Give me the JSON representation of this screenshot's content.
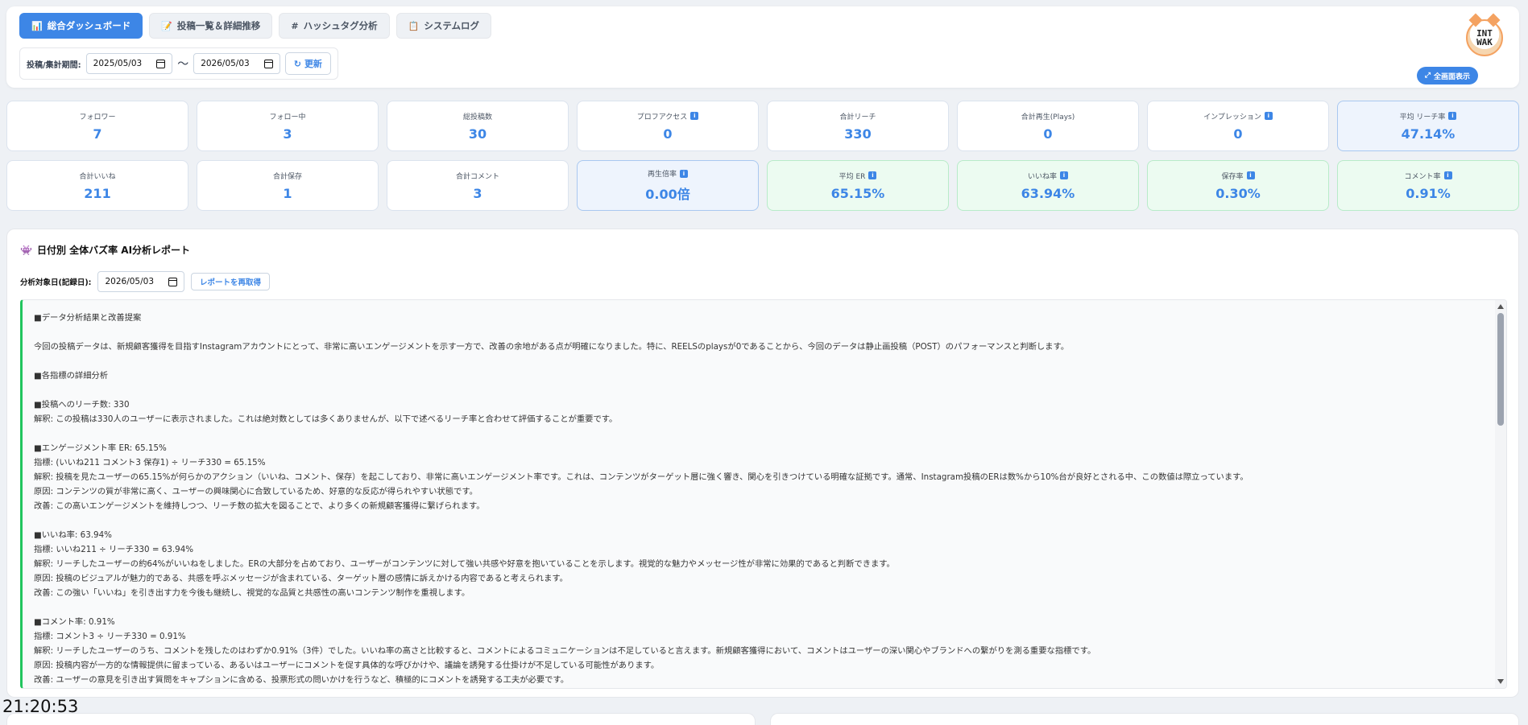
{
  "tabs": [
    {
      "icon": "📊",
      "label": "総合ダッシュボード"
    },
    {
      "icon": "📝",
      "label": "投稿一覧＆詳細推移"
    },
    {
      "icon": "#",
      "label": "ハッシュタグ分析"
    },
    {
      "icon": "📋",
      "label": "システムログ"
    }
  ],
  "period": {
    "label": "投稿/集計期間:",
    "start": "2025/05/03",
    "separator": "〜",
    "end": "2026/05/03",
    "refresh_label": "更新"
  },
  "header": {
    "logo_text": "INT WAK",
    "fullscreen_label": "全画面表示"
  },
  "kpis_row1": [
    {
      "label": "フォロワー",
      "value": "7"
    },
    {
      "label": "フォロー中",
      "value": "3"
    },
    {
      "label": "総投稿数",
      "value": "30"
    },
    {
      "label": "プロフアクセス",
      "value": "0"
    },
    {
      "label": "合計リーチ",
      "value": "330"
    },
    {
      "label": "合計再生(Plays)",
      "value": "0"
    },
    {
      "label": "インプレッション",
      "value": "0"
    },
    {
      "label": "平均 リーチ率",
      "value": "47.14%"
    }
  ],
  "kpis_row2": [
    {
      "label": "合計いいね",
      "value": "211"
    },
    {
      "label": "合計保存",
      "value": "1"
    },
    {
      "label": "合計コメント",
      "value": "3"
    },
    {
      "label": "再生倍率",
      "value": "0.00倍"
    },
    {
      "label": "平均 ER",
      "value": "65.15%"
    },
    {
      "label": "いいね率",
      "value": "63.94%"
    },
    {
      "label": "保存率",
      "value": "0.30%"
    },
    {
      "label": "コメント率",
      "value": "0.91%"
    }
  ],
  "report": {
    "title": "日付別 全体バズ率 AI分析レポート",
    "date_label": "分析対象日(記録日):",
    "date_value": "2026/05/03",
    "refetch_label": "レポートを再取得",
    "lines": [
      "■データ分析結果と改善提案",
      "",
      "今回の投稿データは、新規顧客獲得を目指すInstagramアカウントにとって、非常に高いエンゲージメントを示す一方で、改善の余地がある点が明確になりました。特に、REELSのplaysが0であることから、今回のデータは静止画投稿（POST）のパフォーマンスと判断します。",
      "",
      "■各指標の詳細分析",
      "",
      "■投稿へのリーチ数: 330",
      "解釈: この投稿は330人のユーザーに表示されました。これは絶対数としては多くありませんが、以下で述べるリーチ率と合わせて評価することが重要です。",
      "",
      "■エンゲージメント率 ER: 65.15%",
      "指標: (いいね211 コメント3 保存1) ÷ リーチ330 = 65.15%",
      "解釈: 投稿を見たユーザーの65.15%が何らかのアクション（いいね、コメント、保存）を起こしており、非常に高いエンゲージメント率です。これは、コンテンツがターゲット層に強く響き、関心を引きつけている明確な証拠です。通常、Instagram投稿のERは数%から10%台が良好とされる中、この数値は際立っています。",
      "原因: コンテンツの質が非常に高く、ユーザーの興味関心に合致しているため、好意的な反応が得られやすい状態です。",
      "改善: この高いエンゲージメントを維持しつつ、リーチ数の拡大を図ることで、より多くの新規顧客獲得に繋げられます。",
      "",
      "■いいね率: 63.94%",
      "指標: いいね211 ÷ リーチ330 = 63.94%",
      "解釈: リーチしたユーザーの約64%がいいねをしました。ERの大部分を占めており、ユーザーがコンテンツに対して強い共感や好意を抱いていることを示します。視覚的な魅力やメッセージ性が非常に効果的であると判断できます。",
      "原因: 投稿のビジュアルが魅力的である、共感を呼ぶメッセージが含まれている、ターゲット層の感情に訴えかける内容であると考えられます。",
      "改善: この強い「いいね」を引き出す力を今後も継続し、視覚的な品質と共感性の高いコンテンツ制作を重視します。",
      "",
      "■コメント率: 0.91%",
      "指標: コメント3 ÷ リーチ330 = 0.91%",
      "解釈: リーチしたユーザーのうち、コメントを残したのはわずか0.91%（3件）でした。いいね率の高さと比較すると、コメントによるコミュニケーションは不足していると言えます。新規顧客獲得において、コメントはユーザーの深い関心やブランドへの繋がりを測る重要な指標です。",
      "原因: 投稿内容が一方的な情報提供に留まっている、あるいはユーザーにコメントを促す具体的な呼びかけや、議論を誘発する仕掛けが不足している可能性があります。",
      "改善: ユーザーの意見を引き出す質問をキャプションに含める、投票形式の問いかけを行うなど、積極的にコメントを誘発する工夫が必要です。"
    ]
  },
  "clock": "21:20:53"
}
